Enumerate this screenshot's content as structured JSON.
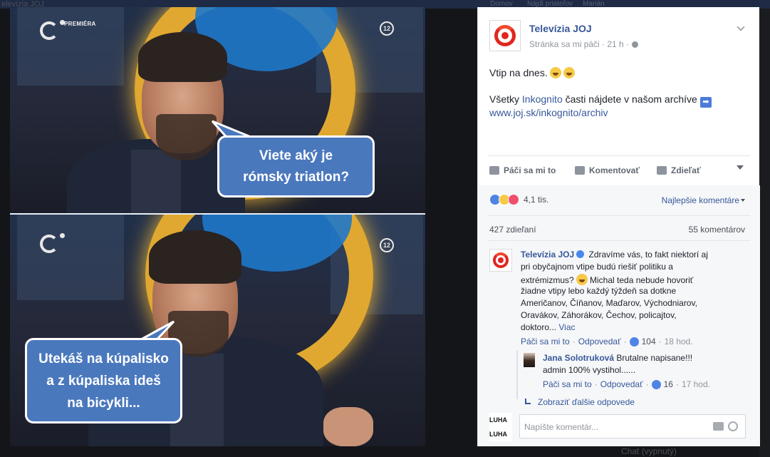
{
  "background": {
    "left_title": "elevízia JOJ",
    "nav_items": [
      "Domov",
      "Nájdi priateľov",
      "Marián"
    ],
    "bottom_text": "Chat (vypnutý)"
  },
  "photo": {
    "channel_badge": "PREMIÉRA",
    "age_rating": "12",
    "bubble_top": "Viete aký je rómsky triatlon?",
    "bubble_bottom": "Utekáš na kúpalisko a z kúpaliska ideš na bicykli...",
    "colors": {
      "bubble_fill": "#4a78bd",
      "bubble_border": "#ffffff"
    }
  },
  "post": {
    "page_name": "Televízia JOJ",
    "meta": "Stránka sa mi páči · 21 h ·",
    "text_line1": "Vtip na dnes.",
    "text_line2_prefix": "Všetky ",
    "text_line2_link": "Inkognito",
    "text_line2_suffix": " časti nájdete v našom archíve",
    "link": "www.joj.sk/inkognito/archiv",
    "actions": {
      "like": "Páči sa mi to",
      "comment": "Komentovať",
      "share": "Zdieľať"
    },
    "reaction_count": "4,1 tis.",
    "sort_label": "Najlepšie komentáre",
    "shares": "427 zdieľaní",
    "comments_count": "55 komentárov",
    "icons": [
      "globe-icon",
      "chevron-down-icon",
      "like-icon",
      "comment-icon",
      "share-icon",
      "camera-icon",
      "smiley-icon"
    ],
    "colors": {
      "link": "#365899",
      "brand_red": "#e2251f"
    }
  },
  "comments": [
    {
      "author": "Televízia JOJ",
      "lines": [
        " Zdravíme vás, to fakt niektorí aj",
        "pri obyčajnom vtipe budú riešiť politiku a",
        "extrémizmus?",
        " Michal teda nebude hovoriť",
        "žiadne vtipy lebo každý týždeň sa dotkne",
        "Američanov, Číňanov, Maďarov, Východniarov,",
        "Oravákov, Záhorákov, Čechov, policajtov,",
        "doktoro..."
      ],
      "more": "Viac",
      "like": "Páči sa mi to",
      "reply": "Odpovedať",
      "likes": "104",
      "time": "18 hod."
    }
  ],
  "reply": {
    "author": "Jana Solotruková",
    "line1": " Brutalne napisane!!!",
    "line2": "admin 100% vystihol......",
    "like": "Páči sa mi to",
    "reply": "Odpovedať",
    "likes": "16",
    "time": "17 hod."
  },
  "more_replies": "Zobraziť ďalšie odpovede",
  "composer": {
    "avatar_text": "LUHA\nLUHA",
    "placeholder": "Napíšte komentár..."
  }
}
